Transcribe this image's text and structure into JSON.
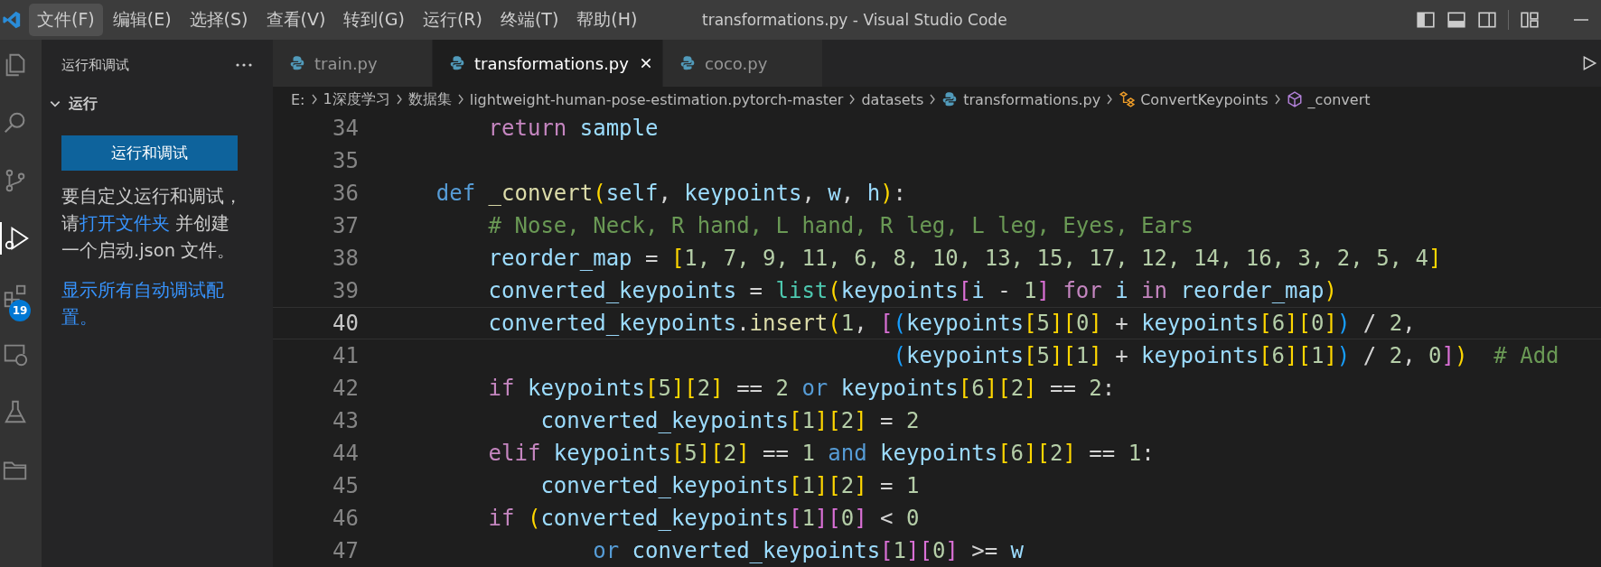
{
  "window": {
    "title": "transformations.py - Visual Studio Code"
  },
  "menu": [
    {
      "label": "文件(F)",
      "selected": true
    },
    {
      "label": "编辑(E)",
      "selected": false
    },
    {
      "label": "选择(S)",
      "selected": false
    },
    {
      "label": "查看(V)",
      "selected": false
    },
    {
      "label": "转到(G)",
      "selected": false
    },
    {
      "label": "运行(R)",
      "selected": false
    },
    {
      "label": "终端(T)",
      "selected": false
    },
    {
      "label": "帮助(H)",
      "selected": false
    }
  ],
  "activity_bar": [
    {
      "kind": "explorer",
      "selected": false
    },
    {
      "kind": "search",
      "selected": false
    },
    {
      "kind": "source-control",
      "selected": false
    },
    {
      "kind": "run",
      "selected": true
    },
    {
      "kind": "extensions",
      "selected": false,
      "badge": "19"
    },
    {
      "kind": "remote",
      "selected": false
    },
    {
      "kind": "testing",
      "selected": false
    },
    {
      "kind": "folder",
      "selected": false
    }
  ],
  "sidebar": {
    "title": "运行和调试",
    "section": {
      "label": "运行",
      "expanded": true
    },
    "button": "运行和调试",
    "message": [
      {
        "text": "要自定义运行和调试，请",
        "kind": "text"
      },
      {
        "text": "打开文件夹",
        "kind": "link"
      },
      {
        "text": " 并创建一个启动.json 文件。",
        "kind": "text"
      }
    ],
    "link": "显示所有自动调试配置。"
  },
  "tabs": [
    {
      "label": "train.py",
      "selected": false
    },
    {
      "label": "transformations.py",
      "selected": true
    },
    {
      "label": "coco.py",
      "selected": false
    }
  ],
  "breadcrumb": [
    {
      "label": "E:",
      "kind": "text"
    },
    {
      "label": "1深度学习",
      "kind": "text"
    },
    {
      "label": "数据集",
      "kind": "text"
    },
    {
      "label": "lightweight-human-pose-estimation.pytorch-master",
      "kind": "text"
    },
    {
      "label": "datasets",
      "kind": "text"
    },
    {
      "label": "transformations.py",
      "kind": "file"
    },
    {
      "label": "ConvertKeypoints",
      "kind": "class"
    },
    {
      "label": "_convert",
      "kind": "method"
    }
  ],
  "code": [
    {
      "number": "34",
      "current": false,
      "tokens": [
        {
          "text": "        return",
          "kind": "k"
        },
        {
          "text": " sample",
          "kind": "v"
        }
      ]
    },
    {
      "number": "35",
      "current": false
    },
    {
      "number": "36",
      "current": false,
      "tokens": [
        {
          "text": "    def",
          "kind": "b"
        },
        {
          "text": " _convert",
          "kind": "f"
        },
        {
          "text": "(",
          "kind": "y"
        },
        {
          "text": "self",
          "kind": "v"
        },
        {
          "text": ", ",
          "kind": "p"
        },
        {
          "text": "keypoints",
          "kind": "v"
        },
        {
          "text": ", ",
          "kind": "p"
        },
        {
          "text": "w",
          "kind": "v"
        },
        {
          "text": ", ",
          "kind": "p"
        },
        {
          "text": "h",
          "kind": "v"
        },
        {
          "text": ")",
          "kind": "y"
        },
        {
          "text": ":",
          "kind": "p"
        }
      ]
    },
    {
      "number": "37",
      "current": false,
      "tokens": [
        {
          "text": "        # Nose, Neck, R hand, L hand, R leg, L leg, Eyes, Ears",
          "kind": "c"
        }
      ]
    },
    {
      "number": "38",
      "current": false,
      "tokens": [
        {
          "text": "        reorder_map",
          "kind": "v"
        },
        {
          "text": " = ",
          "kind": "p"
        },
        {
          "text": "[",
          "kind": "y"
        },
        {
          "text": "1, 7, 9, 11, 6, 8, 10, 13, 15, 17, 12, 14, 16, 3, 2, 5, 4",
          "kind": "n"
        },
        {
          "text": "]",
          "kind": "y"
        }
      ]
    },
    {
      "number": "39",
      "current": false,
      "tokens": [
        {
          "text": "        converted_keypoints",
          "kind": "v"
        },
        {
          "text": " = ",
          "kind": "p"
        },
        {
          "text": "list",
          "kind": "t"
        },
        {
          "text": "(",
          "kind": "y"
        },
        {
          "text": "keypoints",
          "kind": "v"
        },
        {
          "text": "[",
          "kind": "m"
        },
        {
          "text": "i",
          "kind": "v"
        },
        {
          "text": " - ",
          "kind": "p"
        },
        {
          "text": "1",
          "kind": "n"
        },
        {
          "text": "]",
          "kind": "m"
        },
        {
          "text": " for",
          "kind": "k"
        },
        {
          "text": " i",
          "kind": "v"
        },
        {
          "text": " in",
          "kind": "k"
        },
        {
          "text": " reorder_map",
          "kind": "v"
        },
        {
          "text": ")",
          "kind": "y"
        }
      ]
    },
    {
      "number": "40",
      "current": true,
      "tokens": [
        {
          "text": "        converted_keypoints",
          "kind": "v"
        },
        {
          "text": ".",
          "kind": "p"
        },
        {
          "text": "insert",
          "kind": "f"
        },
        {
          "text": "(",
          "kind": "y"
        },
        {
          "text": "1",
          "kind": "n"
        },
        {
          "text": ", ",
          "kind": "p"
        },
        {
          "text": "[",
          "kind": "m"
        },
        {
          "text": "(",
          "kind": "u"
        },
        {
          "text": "keypoints",
          "kind": "v"
        },
        {
          "text": "[",
          "kind": "y"
        },
        {
          "text": "5",
          "kind": "n"
        },
        {
          "text": "]",
          "kind": "y"
        },
        {
          "text": "[",
          "kind": "y"
        },
        {
          "text": "0",
          "kind": "n"
        },
        {
          "text": "]",
          "kind": "y"
        },
        {
          "text": " + ",
          "kind": "p"
        },
        {
          "text": "keypoints",
          "kind": "v"
        },
        {
          "text": "[",
          "kind": "y"
        },
        {
          "text": "6",
          "kind": "n"
        },
        {
          "text": "]",
          "kind": "y"
        },
        {
          "text": "[",
          "kind": "y"
        },
        {
          "text": "0",
          "kind": "n"
        },
        {
          "text": "]",
          "kind": "y"
        },
        {
          "text": ")",
          "kind": "u"
        },
        {
          "text": " / ",
          "kind": "p"
        },
        {
          "text": "2",
          "kind": "n"
        },
        {
          "text": ",",
          "kind": "p"
        }
      ]
    },
    {
      "number": "41",
      "current": false,
      "tokens": [
        {
          "text": "                                       (",
          "kind": "u"
        },
        {
          "text": "keypoints",
          "kind": "v"
        },
        {
          "text": "[",
          "kind": "y"
        },
        {
          "text": "5",
          "kind": "n"
        },
        {
          "text": "]",
          "kind": "y"
        },
        {
          "text": "[",
          "kind": "y"
        },
        {
          "text": "1",
          "kind": "n"
        },
        {
          "text": "]",
          "kind": "y"
        },
        {
          "text": " + ",
          "kind": "p"
        },
        {
          "text": "keypoints",
          "kind": "v"
        },
        {
          "text": "[",
          "kind": "y"
        },
        {
          "text": "6",
          "kind": "n"
        },
        {
          "text": "]",
          "kind": "y"
        },
        {
          "text": "[",
          "kind": "y"
        },
        {
          "text": "1",
          "kind": "n"
        },
        {
          "text": "]",
          "kind": "y"
        },
        {
          "text": ")",
          "kind": "u"
        },
        {
          "text": " / ",
          "kind": "p"
        },
        {
          "text": "2",
          "kind": "n"
        },
        {
          "text": ", ",
          "kind": "p"
        },
        {
          "text": "0",
          "kind": "n"
        },
        {
          "text": "]",
          "kind": "m"
        },
        {
          "text": ")",
          "kind": "y"
        },
        {
          "text": "  # Add",
          "kind": "c"
        }
      ]
    },
    {
      "number": "42",
      "current": false,
      "tokens": [
        {
          "text": "        if",
          "kind": "k"
        },
        {
          "text": " keypoints",
          "kind": "v"
        },
        {
          "text": "[",
          "kind": "y"
        },
        {
          "text": "5",
          "kind": "n"
        },
        {
          "text": "]",
          "kind": "y"
        },
        {
          "text": "[",
          "kind": "y"
        },
        {
          "text": "2",
          "kind": "n"
        },
        {
          "text": "]",
          "kind": "y"
        },
        {
          "text": " == ",
          "kind": "p"
        },
        {
          "text": "2",
          "kind": "n"
        },
        {
          "text": " or",
          "kind": "b"
        },
        {
          "text": " keypoints",
          "kind": "v"
        },
        {
          "text": "[",
          "kind": "y"
        },
        {
          "text": "6",
          "kind": "n"
        },
        {
          "text": "]",
          "kind": "y"
        },
        {
          "text": "[",
          "kind": "y"
        },
        {
          "text": "2",
          "kind": "n"
        },
        {
          "text": "]",
          "kind": "y"
        },
        {
          "text": " == ",
          "kind": "p"
        },
        {
          "text": "2",
          "kind": "n"
        },
        {
          "text": ":",
          "kind": "p"
        }
      ]
    },
    {
      "number": "43",
      "current": false,
      "tokens": [
        {
          "text": "            converted_keypoints",
          "kind": "v"
        },
        {
          "text": "[",
          "kind": "y"
        },
        {
          "text": "1",
          "kind": "n"
        },
        {
          "text": "]",
          "kind": "y"
        },
        {
          "text": "[",
          "kind": "y"
        },
        {
          "text": "2",
          "kind": "n"
        },
        {
          "text": "]",
          "kind": "y"
        },
        {
          "text": " = ",
          "kind": "p"
        },
        {
          "text": "2",
          "kind": "n"
        }
      ]
    },
    {
      "number": "44",
      "current": false,
      "tokens": [
        {
          "text": "        elif",
          "kind": "k"
        },
        {
          "text": " keypoints",
          "kind": "v"
        },
        {
          "text": "[",
          "kind": "y"
        },
        {
          "text": "5",
          "kind": "n"
        },
        {
          "text": "]",
          "kind": "y"
        },
        {
          "text": "[",
          "kind": "y"
        },
        {
          "text": "2",
          "kind": "n"
        },
        {
          "text": "]",
          "kind": "y"
        },
        {
          "text": " == ",
          "kind": "p"
        },
        {
          "text": "1",
          "kind": "n"
        },
        {
          "text": " and",
          "kind": "b"
        },
        {
          "text": " keypoints",
          "kind": "v"
        },
        {
          "text": "[",
          "kind": "y"
        },
        {
          "text": "6",
          "kind": "n"
        },
        {
          "text": "]",
          "kind": "y"
        },
        {
          "text": "[",
          "kind": "y"
        },
        {
          "text": "2",
          "kind": "n"
        },
        {
          "text": "]",
          "kind": "y"
        },
        {
          "text": " == ",
          "kind": "p"
        },
        {
          "text": "1",
          "kind": "n"
        },
        {
          "text": ":",
          "kind": "p"
        }
      ]
    },
    {
      "number": "45",
      "current": false,
      "tokens": [
        {
          "text": "            converted_keypoints",
          "kind": "v"
        },
        {
          "text": "[",
          "kind": "y"
        },
        {
          "text": "1",
          "kind": "n"
        },
        {
          "text": "]",
          "kind": "y"
        },
        {
          "text": "[",
          "kind": "y"
        },
        {
          "text": "2",
          "kind": "n"
        },
        {
          "text": "]",
          "kind": "y"
        },
        {
          "text": " = ",
          "kind": "p"
        },
        {
          "text": "1",
          "kind": "n"
        }
      ]
    },
    {
      "number": "46",
      "current": false,
      "tokens": [
        {
          "text": "        if",
          "kind": "k"
        },
        {
          "text": " (",
          "kind": "y"
        },
        {
          "text": "converted_keypoints",
          "kind": "v"
        },
        {
          "text": "[",
          "kind": "m"
        },
        {
          "text": "1",
          "kind": "n"
        },
        {
          "text": "]",
          "kind": "m"
        },
        {
          "text": "[",
          "kind": "m"
        },
        {
          "text": "0",
          "kind": "n"
        },
        {
          "text": "]",
          "kind": "m"
        },
        {
          "text": " < ",
          "kind": "p"
        },
        {
          "text": "0",
          "kind": "n"
        }
      ]
    },
    {
      "number": "47",
      "current": false,
      "tokens": [
        {
          "text": "                or",
          "kind": "b"
        },
        {
          "text": " converted_keypoints",
          "kind": "v"
        },
        {
          "text": "[",
          "kind": "m"
        },
        {
          "text": "1",
          "kind": "n"
        },
        {
          "text": "]",
          "kind": "m"
        },
        {
          "text": "[",
          "kind": "m"
        },
        {
          "text": "0",
          "kind": "n"
        },
        {
          "text": "]",
          "kind": "m"
        },
        {
          "text": " >= ",
          "kind": "p"
        },
        {
          "text": "w",
          "kind": "v"
        }
      ]
    }
  ]
}
